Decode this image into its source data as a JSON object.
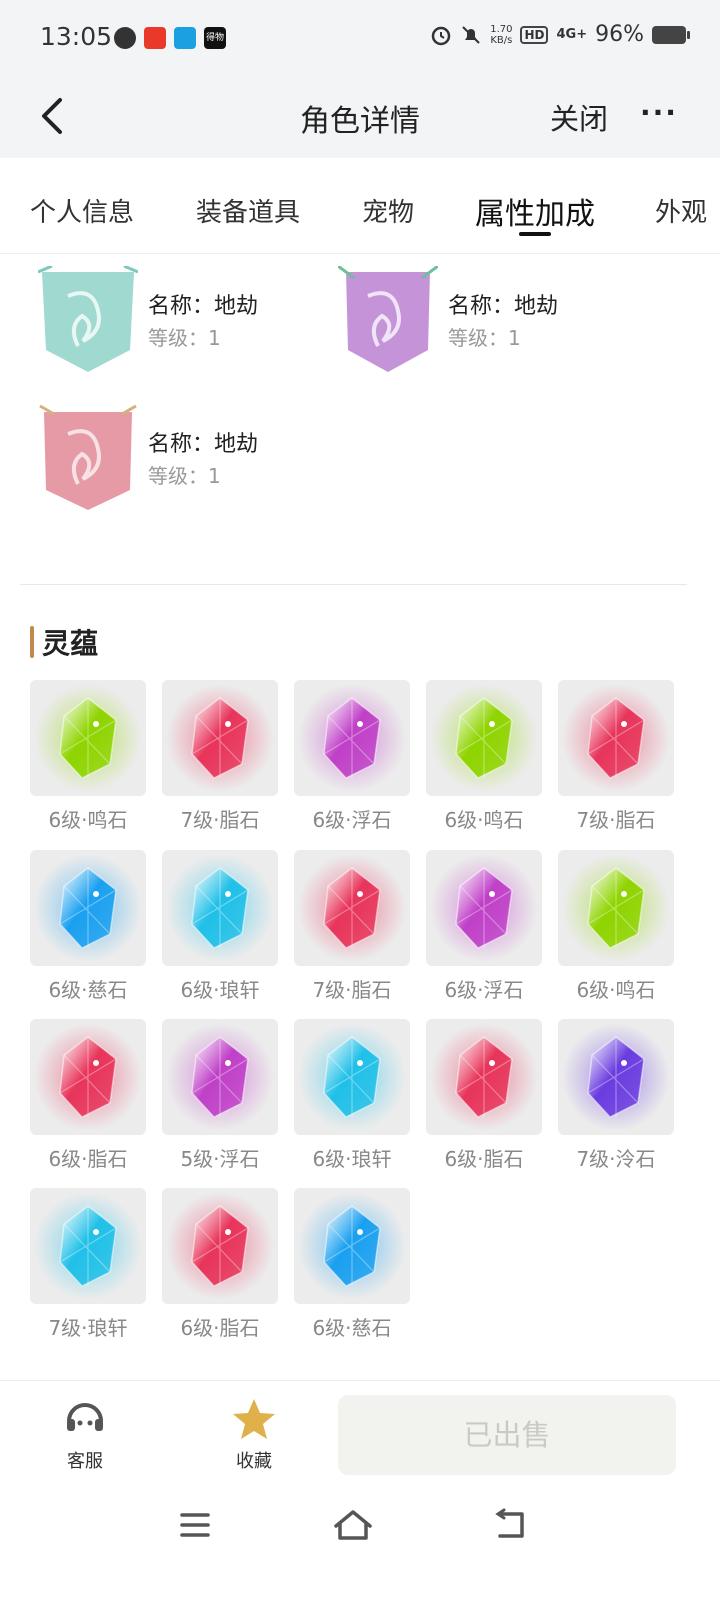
{
  "status": {
    "time": "13:05",
    "net_speed_top": "1.70",
    "net_speed_bottom": "KB/s",
    "hd": "HD",
    "network": "4G+",
    "battery": "96%",
    "app_badge_label": "得物"
  },
  "nav": {
    "title": "角色详情",
    "close_label": "关闭",
    "more_label": "···"
  },
  "tabs": [
    "个人信息",
    "装备道具",
    "宠物",
    "属性加成",
    "外观"
  ],
  "banners": [
    {
      "name": "名称：地劫",
      "level": "等级：1",
      "color": "#9fd9cf"
    },
    {
      "name": "名称：地劫",
      "level": "等级：1",
      "color": "#c594d8"
    },
    {
      "name": "名称：地劫",
      "level": "等级：1",
      "color": "#e69aa6"
    }
  ],
  "section": {
    "title": "灵蕴"
  },
  "gems": [
    {
      "label": "6级·鸣石",
      "kind": "green"
    },
    {
      "label": "7级·脂石",
      "kind": "red"
    },
    {
      "label": "6级·浮石",
      "kind": "purple"
    },
    {
      "label": "6级·鸣石",
      "kind": "green"
    },
    {
      "label": "7级·脂石",
      "kind": "red"
    },
    {
      "label": "6级·慈石",
      "kind": "blue"
    },
    {
      "label": "6级·琅轩",
      "kind": "cyan"
    },
    {
      "label": "7级·脂石",
      "kind": "red"
    },
    {
      "label": "6级·浮石",
      "kind": "purple"
    },
    {
      "label": "6级·鸣石",
      "kind": "green"
    },
    {
      "label": "6级·脂石",
      "kind": "red"
    },
    {
      "label": "5级·浮石",
      "kind": "purple"
    },
    {
      "label": "6级·琅轩",
      "kind": "cyan"
    },
    {
      "label": "6级·脂石",
      "kind": "red"
    },
    {
      "label": "7级·泠石",
      "kind": "violet"
    },
    {
      "label": "7级·琅轩",
      "kind": "cyan"
    },
    {
      "label": "6级·脂石",
      "kind": "red"
    },
    {
      "label": "6级·慈石",
      "kind": "blue"
    }
  ],
  "bottom": {
    "service_label": "客服",
    "favorite_label": "收藏",
    "sold_label": "已出售"
  },
  "colors": {
    "accent_bar": "#c08a4f",
    "star": "#e0b04a",
    "gem_green": "#8fd400",
    "gem_red": "#e8345a",
    "gem_purple": "#c040c8",
    "gem_blue": "#1aa0f0",
    "gem_cyan": "#20c0e8",
    "gem_violet": "#6a3ce0"
  }
}
